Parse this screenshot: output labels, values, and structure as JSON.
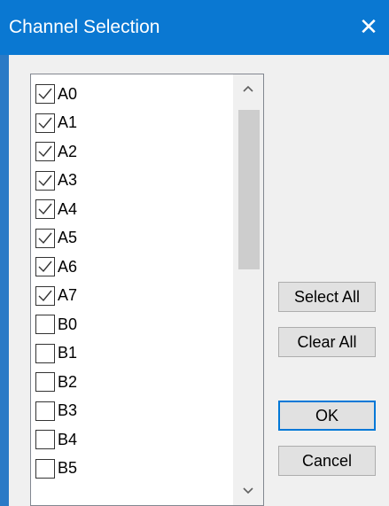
{
  "window": {
    "title": "Channel Selection",
    "close_glyph": "✕",
    "accent": "#0a78d2"
  },
  "list": {
    "items": [
      {
        "label": "A0",
        "checked": true
      },
      {
        "label": "A1",
        "checked": true
      },
      {
        "label": "A2",
        "checked": true
      },
      {
        "label": "A3",
        "checked": true
      },
      {
        "label": "A4",
        "checked": true
      },
      {
        "label": "A5",
        "checked": true
      },
      {
        "label": "A6",
        "checked": true
      },
      {
        "label": "A7",
        "checked": true
      },
      {
        "label": "B0",
        "checked": false
      },
      {
        "label": "B1",
        "checked": false
      },
      {
        "label": "B2",
        "checked": false
      },
      {
        "label": "B3",
        "checked": false
      },
      {
        "label": "B4",
        "checked": false
      },
      {
        "label": "B5",
        "checked": false
      }
    ]
  },
  "buttons": {
    "select_all": "Select All",
    "clear_all": "Clear All",
    "ok": "OK",
    "cancel": "Cancel"
  },
  "icons": {
    "close": "close-icon",
    "scroll_up": "chevron-up-icon",
    "scroll_down": "chevron-down-icon",
    "check": "checkmark-icon"
  }
}
